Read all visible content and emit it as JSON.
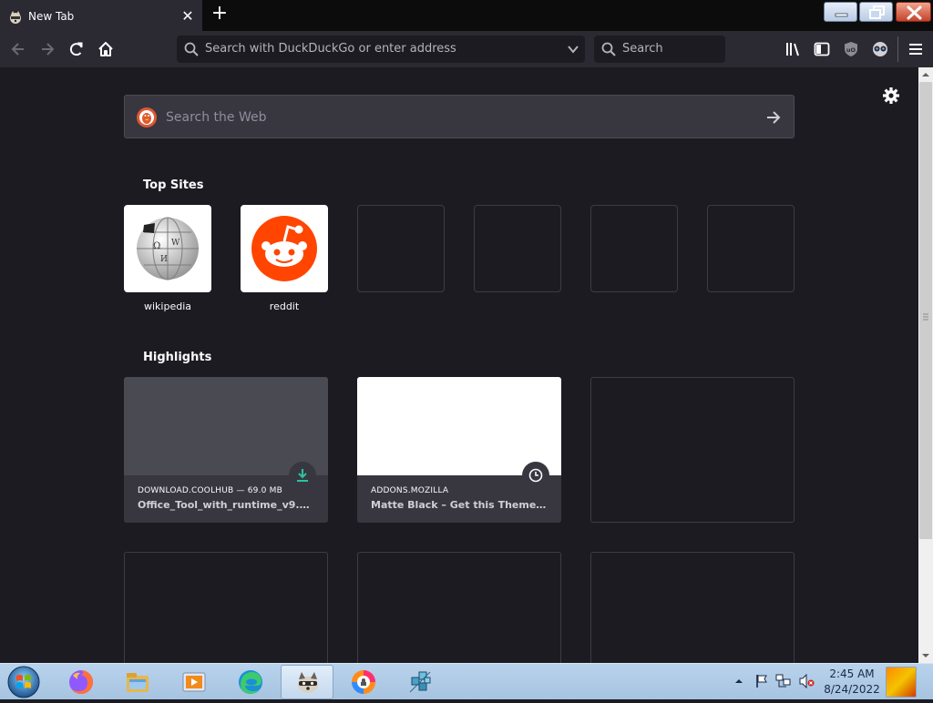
{
  "browser": {
    "tab": {
      "title": "New Tab",
      "close": "✕"
    },
    "new_tab": "+",
    "urlbar": {
      "placeholder": "Search with DuckDuckGo or enter address"
    },
    "searchbar": {
      "placeholder": "Search"
    }
  },
  "content": {
    "web_search": {
      "placeholder": "Search the Web"
    },
    "top_sites": {
      "title": "Top Sites",
      "sites": [
        {
          "label": "wikipedia",
          "icon": "wikipedia-globe-icon"
        },
        {
          "label": "reddit",
          "icon": "reddit-alien-icon"
        }
      ]
    },
    "highlights": {
      "title": "Highlights",
      "cards": [
        {
          "source": "DOWNLOAD.COOLHUB — 69.0 MB",
          "title": "Office_Tool_with_runtime_v9.0.…",
          "badge": "download-icon"
        },
        {
          "source": "ADDONS.MOZILLA",
          "title": "Matte Black – Get this Theme fo…",
          "badge": "clock-icon"
        }
      ]
    }
  },
  "taskbar": {
    "apps": [
      "firefox-icon",
      "file-explorer-icon",
      "media-player-icon",
      "edge-icon",
      "firefox-raccoon-icon",
      "privacy-browser-icon",
      "network-cubes-icon"
    ],
    "clock": {
      "time": "2:45 AM",
      "date": "8/24/2022"
    }
  },
  "colors": {
    "chrome": "#2b2a33",
    "content_bg": "#1c1b22",
    "card": "#38373f",
    "reddit": "#ff4500",
    "download_green": "#2ac3a2"
  }
}
